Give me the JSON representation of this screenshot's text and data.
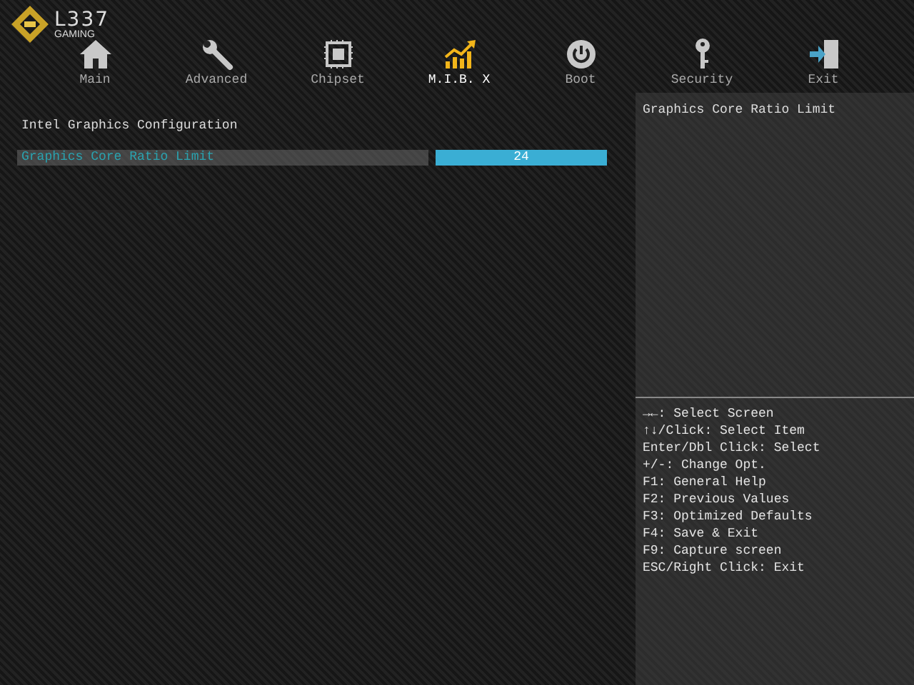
{
  "logo": {
    "name": "L337",
    "subtitle": "GAMING"
  },
  "tabs": [
    {
      "label": "Main",
      "kind": "home",
      "selected": false
    },
    {
      "label": "Advanced",
      "kind": "wrench",
      "selected": false
    },
    {
      "label": "Chipset",
      "kind": "chip",
      "selected": false
    },
    {
      "label": "M.I.B. X",
      "kind": "chart",
      "selected": true
    },
    {
      "label": "Boot",
      "kind": "power",
      "selected": false
    },
    {
      "label": "Security",
      "kind": "key",
      "selected": false
    },
    {
      "label": "Exit",
      "kind": "exit",
      "selected": false
    }
  ],
  "section_title": "Intel Graphics Configuration",
  "settings": [
    {
      "label": "Graphics Core Ratio Limit",
      "value": "24",
      "selected": true
    }
  ],
  "help_panel": {
    "description": "Graphics Core Ratio Limit",
    "keys": [
      "→←: Select Screen",
      "↑↓/Click: Select Item",
      "Enter/Dbl Click: Select",
      "+/-: Change Opt.",
      "F1: General Help",
      "F2: Previous Values",
      "F3: Optimized Defaults",
      "F4: Save & Exit",
      "F9: Capture screen",
      "ESC/Right Click: Exit"
    ]
  }
}
